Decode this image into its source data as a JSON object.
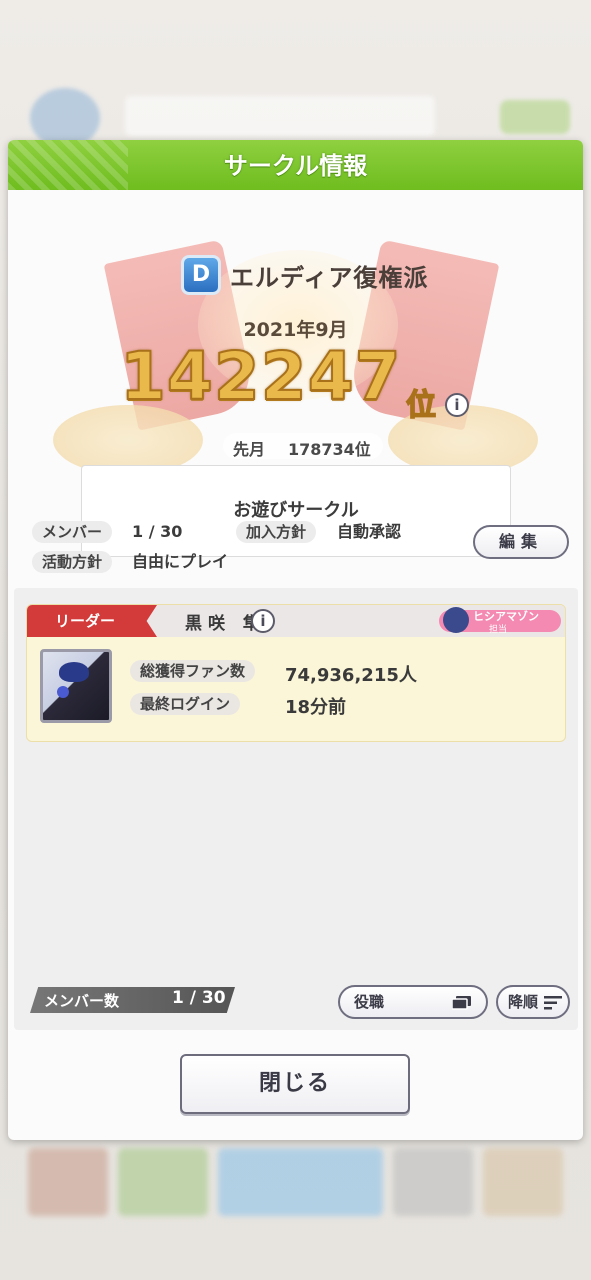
{
  "modal": {
    "title": "サークル情報",
    "circle_name": "エルディア復権派",
    "emblem_letter": "D",
    "rank_month": "2021年9月",
    "rank_number": "142247",
    "rank_suffix": "位",
    "prev_month_label": "先月",
    "prev_month_value": "178734位",
    "motto": "お遊びサークル",
    "info": {
      "members_label": "メンバー",
      "members_value": "1 / 30",
      "join_policy_label": "加入方針",
      "join_policy_value": "自動承認",
      "activity_label": "活動方針",
      "activity_value": "自由にプレイ"
    },
    "edit_label": "編集",
    "close_label": "閉じる"
  },
  "members": {
    "leader_tag": "リーダー",
    "leader_name": "黒咲 隼",
    "trainer_name": "ヒシアマゾン",
    "trainer_role": "担当",
    "fans_label": "総獲得ファン数",
    "fans_value": "74,936,215人",
    "last_login_label": "最終ログイン",
    "last_login_value": "18分前",
    "count_label": "メンバー数",
    "count_value": "1 / 30",
    "role_sort_label": "役職",
    "order_sort_label": "降順"
  },
  "colors": {
    "header_green": "#7cc62f",
    "leader_red": "#d33b3a",
    "rank_gold": "#e9b94b",
    "card_yellow": "#fbf6d8"
  }
}
